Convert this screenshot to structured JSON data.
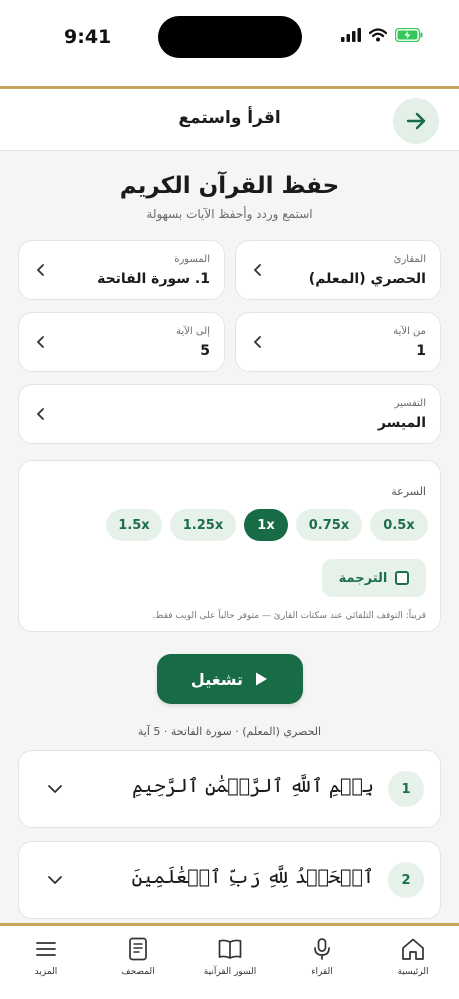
{
  "status_bar": {
    "time": "9:41",
    "icons": [
      "signal-icon",
      "wifi-icon",
      "battery-charging-icon"
    ],
    "battery_color": "#34c759"
  },
  "header": {
    "title": "اقرأ واستمع",
    "back_icon": "arrow-right-icon"
  },
  "page": {
    "title": "حفظ القرآن الكريم",
    "subtitle": "استمع وردد وأحفظ الآيات بسهولة"
  },
  "selectors": {
    "reciter": {
      "label": "المقارئ",
      "value": "الحصري (المعلم)"
    },
    "surah": {
      "label": "المسورة",
      "value": "1. سورة الفاتحة"
    },
    "from_ayah": {
      "label": "من الآية",
      "value": "1"
    },
    "to_ayah": {
      "label": "إلى الآية",
      "value": "5"
    },
    "tafsir": {
      "label": "التفسير",
      "value": "الميسر"
    }
  },
  "speed": {
    "label": "السرعة",
    "options": [
      "1.5x",
      "1.25x",
      "1x",
      "0.75x",
      "0.5x"
    ],
    "selected": "1x"
  },
  "translation": {
    "label": "الترجمة",
    "checked": false
  },
  "hint": "قريباً: التوقف التلقائي عند سكتات القارئ — متوفر حالياً على الويب فقط.",
  "play": {
    "label": "تشغيل"
  },
  "info_line": "الحصري (المعلم) · سورة الفاتحة · 5 آية",
  "ayahs": [
    {
      "number": "1",
      "text": "بِسۡمِ ٱللَّهِ ٱلرَّحۡمَٰنِ ٱلرَّحِيمِ"
    },
    {
      "number": "2",
      "text": "ٱلۡحَمۡدُ لِلَّهِ رَبِّ ٱلۡعَٰلَمِينَ"
    }
  ],
  "tabs": [
    {
      "label": "الرئيسية",
      "icon": "home-icon"
    },
    {
      "label": "القراء",
      "icon": "microphone-icon"
    },
    {
      "label": "السور القرآنية",
      "icon": "book-open-icon"
    },
    {
      "label": "المصحف",
      "icon": "document-icon"
    },
    {
      "label": "المزيد",
      "icon": "menu-icon"
    }
  ],
  "colors": {
    "primary": "#176b45",
    "primary_light": "#e6f1ea",
    "gold": "#c8a45a",
    "background": "#f5f5f5"
  }
}
